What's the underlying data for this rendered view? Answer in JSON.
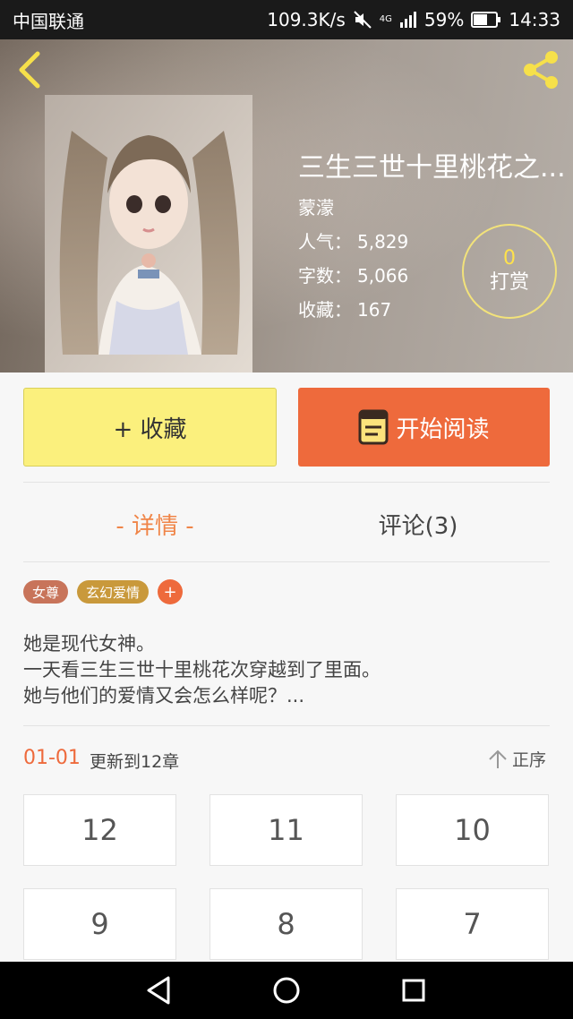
{
  "status_bar": {
    "carrier": "中国联通",
    "speed": "109.3K/s",
    "network": "4G",
    "battery": "59%",
    "time": "14:33"
  },
  "book": {
    "title": "三生三世十里桃花之...",
    "author": "蒙濛",
    "stats": [
      {
        "label": "人气：",
        "value": "5,829"
      },
      {
        "label": "字数：",
        "value": "5,066"
      },
      {
        "label": "收藏：",
        "value": "167"
      }
    ],
    "tip": {
      "count": "0",
      "label": "打赏"
    }
  },
  "actions": {
    "favorite_label": "+ 收藏",
    "read_label": "开始阅读"
  },
  "tabs": {
    "details": "- 详情 -",
    "comments": "评论(3)"
  },
  "tags": [
    {
      "label": "女尊",
      "color": "#c8745a"
    },
    {
      "label": "玄幻爱情",
      "color": "#c9993b"
    }
  ],
  "tag_add": "+",
  "description": [
    "她是现代女神。",
    "一天看三生三世十里桃花次穿越到了里面。",
    "她与他们的爱情又会怎么样呢？..."
  ],
  "update": {
    "date": "01-01",
    "text": "更新到12章",
    "sort_label": "正序"
  },
  "chapters": [
    "12",
    "11",
    "10",
    "9",
    "8",
    "7"
  ],
  "colors": {
    "accent": "#ee6a3c",
    "favorite_bg": "#fbf07d",
    "tab_active": "#f08548",
    "tip_number": "#ffe24a",
    "icon_yellow": "#f6e04a"
  }
}
